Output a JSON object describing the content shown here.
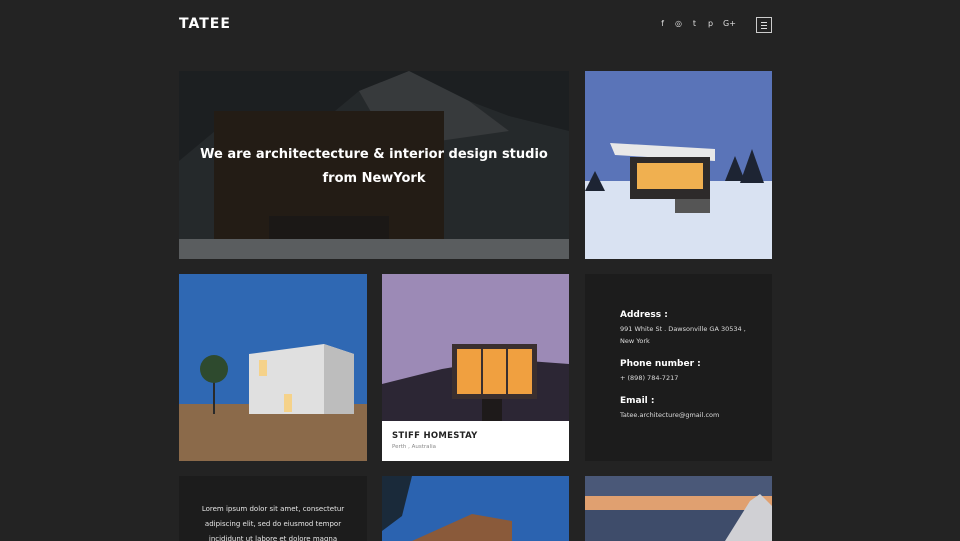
{
  "header": {
    "logo": "TATEE",
    "social": [
      {
        "icon": "facebook-icon",
        "glyph": "f"
      },
      {
        "icon": "instagram-icon",
        "glyph": "◎"
      },
      {
        "icon": "twitter-icon",
        "glyph": "t"
      },
      {
        "icon": "pinterest-icon",
        "glyph": "p"
      },
      {
        "icon": "google-plus-icon",
        "glyph": "G+"
      }
    ],
    "menu_icon": "hamburger-menu-icon"
  },
  "hero": {
    "line1": "We are architectecture & interior design studio",
    "line2": "from NewYork"
  },
  "project": {
    "title": "STIFF HOMESTAY",
    "location": "Perth ,  Australia"
  },
  "contact": {
    "address_label": "Address :",
    "address_line1": "991 White St . Dawsonville GA 30534 ,",
    "address_line2": "New York",
    "phone_label": "Phone number :",
    "phone": "+ (898) 784-7217",
    "email_label": "Email :",
    "email": "Tatee.architecture@gmail.com"
  },
  "about": {
    "line1": "Lorem ipsum dolor sit amet, consectetur",
    "line2": "adipiscing elit, sed do eiusmod tempor",
    "line3": "incididunt ut labore et dolore magna"
  },
  "colors": {
    "background": "#232323",
    "card_dark": "#1c1c1c",
    "text": "#ffffff"
  }
}
